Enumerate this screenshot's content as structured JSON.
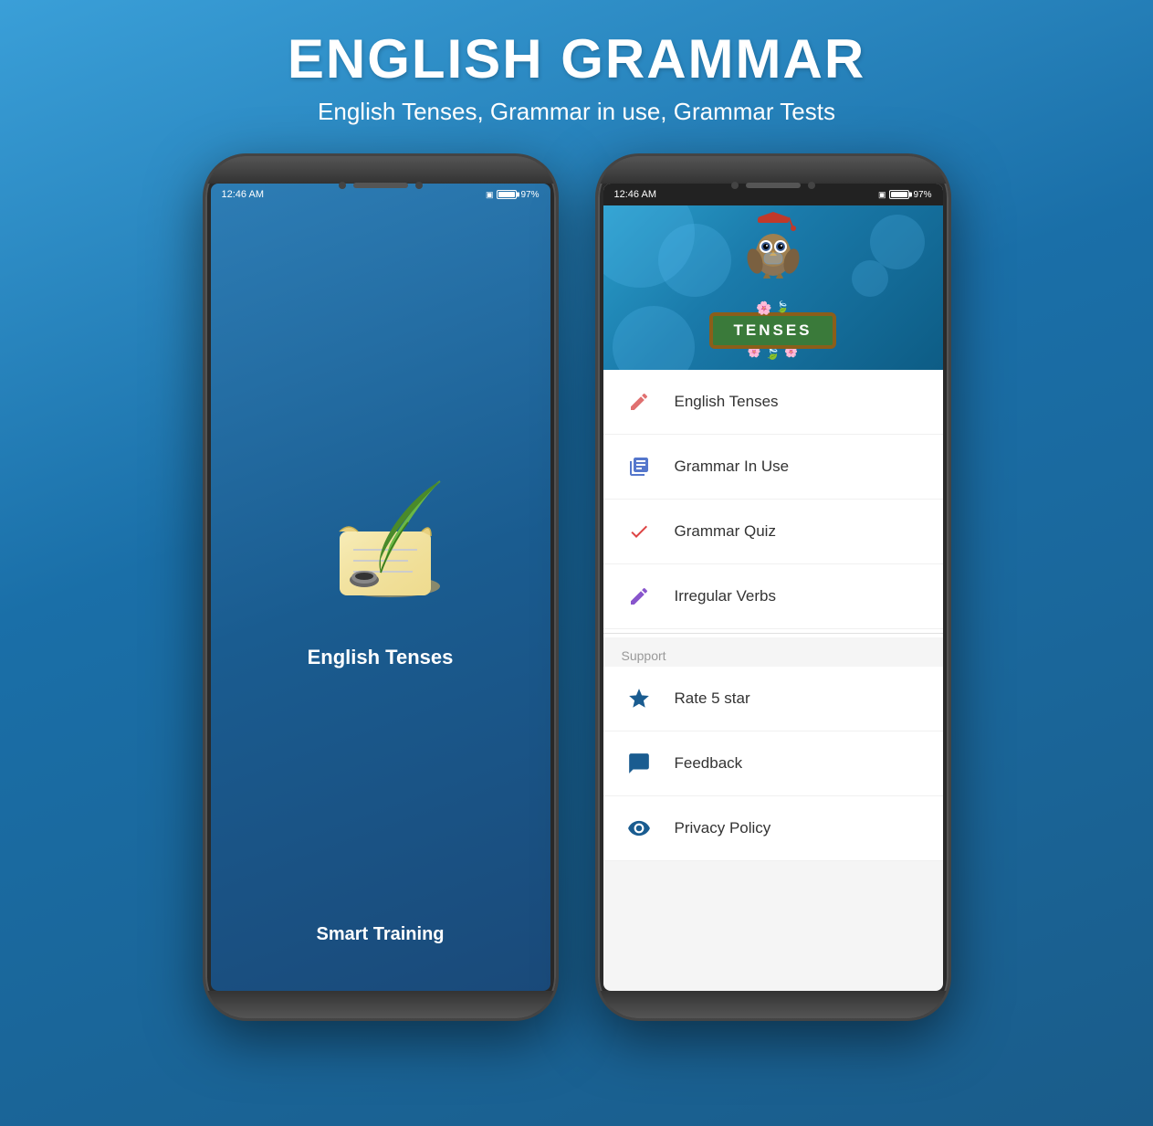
{
  "header": {
    "title": "ENGLISH GRAMMAR",
    "subtitle": "English Tenses, Grammar in use, Grammar Tests"
  },
  "phone_left": {
    "status_bar": {
      "time": "12:46 AM",
      "battery": "97%"
    },
    "app_title": "English Tenses",
    "smart_training": "Smart Training"
  },
  "phone_right": {
    "status_bar": {
      "time": "12:46 AM",
      "battery": "97%"
    },
    "banner_text": "TENSES",
    "menu_items": [
      {
        "label": "English Tenses",
        "icon": "✏️",
        "icon_type": "pencil"
      },
      {
        "label": "Grammar In Use",
        "icon": "📋",
        "icon_type": "book"
      },
      {
        "label": "Grammar Quiz",
        "icon": "✔",
        "icon_type": "check"
      },
      {
        "label": "Irregular Verbs",
        "icon": "✍",
        "icon_type": "verb"
      }
    ],
    "section_support": "Support",
    "support_items": [
      {
        "label": "Rate 5 star",
        "icon": "★",
        "icon_type": "star"
      },
      {
        "label": "Feedback",
        "icon": "💬",
        "icon_type": "chat"
      },
      {
        "label": "Privacy Policy",
        "icon": "👁",
        "icon_type": "eye"
      }
    ]
  }
}
